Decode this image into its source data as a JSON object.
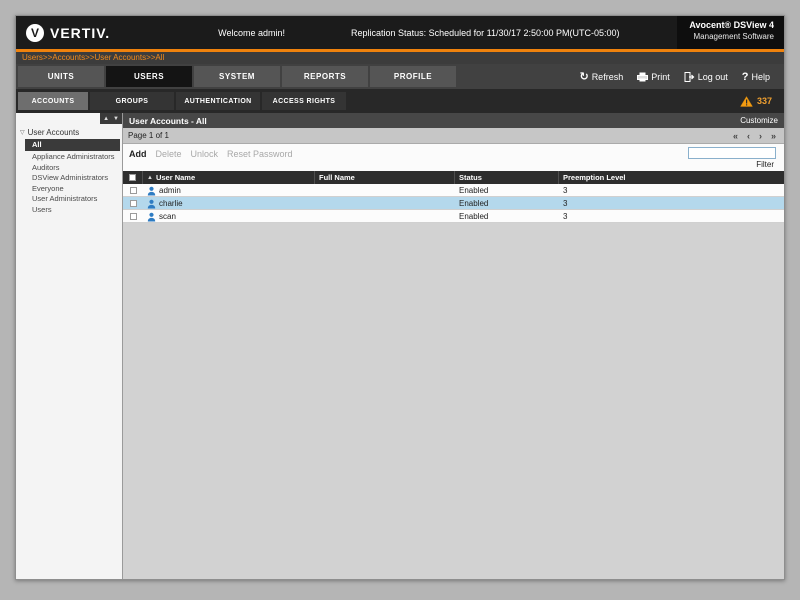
{
  "header": {
    "logo_text": "VERTIV.",
    "logo_letter": "V",
    "welcome": "Welcome admin!",
    "replication_status": "Replication Status: Scheduled for 11/30/17 2:50:00 PM(UTC-05:00)",
    "product_line1": "Avocent® DSView 4",
    "product_line2": "Management Software"
  },
  "breadcrumb": "Users>>Accounts>>User Accounts>>All",
  "top_tabs": [
    {
      "label": "UNITS"
    },
    {
      "label": "USERS"
    },
    {
      "label": "SYSTEM"
    },
    {
      "label": "REPORTS"
    },
    {
      "label": "PROFILE"
    }
  ],
  "top_actions": [
    {
      "label": "Refresh"
    },
    {
      "label": "Print"
    },
    {
      "label": "Log out"
    },
    {
      "label": "Help"
    }
  ],
  "sub_tabs": [
    {
      "label": "ACCOUNTS"
    },
    {
      "label": "GROUPS"
    },
    {
      "label": "AUTHENTICATION"
    },
    {
      "label": "ACCESS RIGHTS"
    }
  ],
  "alert_count": "337",
  "icons": {
    "refresh": "↻",
    "help": "?",
    "first_page": "«",
    "prev_page": "‹",
    "next_page": "›",
    "last_page": "»",
    "sort_asc": "▲",
    "scroll_up": "▲",
    "scroll_down": "▼",
    "tree_expander": "▽"
  },
  "sidebar": {
    "root": "User Accounts",
    "items": [
      {
        "label": "All",
        "selected": true
      },
      {
        "label": "Appliance Administrators"
      },
      {
        "label": "Auditors"
      },
      {
        "label": "DSView Administrators"
      },
      {
        "label": "Everyone"
      },
      {
        "label": "User Administrators"
      },
      {
        "label": "Users"
      }
    ]
  },
  "main": {
    "title": "User Accounts - All",
    "customize": "Customize",
    "page_info": "Page 1 of 1",
    "actions": [
      "Add",
      "Delete",
      "Unlock",
      "Reset Password"
    ],
    "filter_label": "Filter",
    "table": {
      "columns": [
        "User Name",
        "Full Name",
        "Status",
        "Preemption Level"
      ],
      "rows": [
        {
          "user": "admin",
          "full_name": "",
          "status": "Enabled",
          "level": "3"
        },
        {
          "user": "charlie",
          "full_name": "",
          "status": "Enabled",
          "level": "3"
        },
        {
          "user": "scan",
          "full_name": "",
          "status": "Enabled",
          "level": "3"
        }
      ]
    }
  }
}
